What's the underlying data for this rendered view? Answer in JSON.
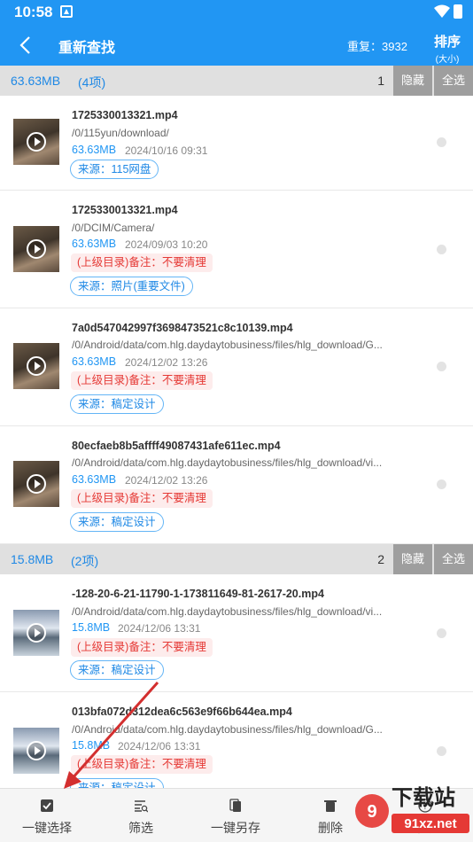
{
  "status_bar": {
    "time": "10:58"
  },
  "app_bar": {
    "title": "重新查找",
    "duplicate_label": "重复：3932",
    "sort_label": "排序",
    "sort_sub": "(大小)"
  },
  "groups": [
    {
      "size": "63.63MB",
      "count": "(4项)",
      "num": "1",
      "hide_label": "隐藏",
      "select_all_label": "全选"
    },
    {
      "size": "15.8MB",
      "count": "(2项)",
      "num": "2",
      "hide_label": "隐藏",
      "select_all_label": "全选"
    }
  ],
  "items": [
    {
      "name": "1725330013321.mp4",
      "path": "/0/115yun/download/",
      "size": "63.63MB",
      "date": "2024/10/16 09:31",
      "note": "",
      "source": "来源：115网盘"
    },
    {
      "name": "1725330013321.mp4",
      "path": "/0/DCIM/Camera/",
      "size": "63.63MB",
      "date": "2024/09/03 10:20",
      "note": "(上级目录)备注：不要清理",
      "source": "来源：照片(重要文件)"
    },
    {
      "name": "7a0d547042997f3698473521c8c10139.mp4",
      "path": "/0/Android/data/com.hlg.daydaytobusiness/files/hlg_download/G...",
      "size": "63.63MB",
      "date": "2024/12/02 13:26",
      "note": "(上级目录)备注：不要清理",
      "source": "来源：稿定设计"
    },
    {
      "name": "80ecfaeb8b5affff49087431afe611ec.mp4",
      "path": "/0/Android/data/com.hlg.daydaytobusiness/files/hlg_download/vi...",
      "size": "63.63MB",
      "date": "2024/12/02 13:26",
      "note": "(上级目录)备注：不要清理",
      "source": "来源：稿定设计"
    },
    {
      "name": "-128-20-6-21-11790-1-173811649-81-2617-20.mp4",
      "path": "/0/Android/data/com.hlg.daydaytobusiness/files/hlg_download/vi...",
      "size": "15.8MB",
      "date": "2024/12/06 13:31",
      "note": "(上级目录)备注：不要清理",
      "source": "来源：稿定设计"
    },
    {
      "name": "013bfa072d312dea6c563e9f66b644ea.mp4",
      "path": "/0/Android/data/com.hlg.daydaytobusiness/files/hlg_download/G...",
      "size": "15.8MB",
      "date": "2024/12/06 13:31",
      "note": "(上级目录)备注：不要清理",
      "source": "来源：稿定设计"
    }
  ],
  "bottom_bar": {
    "select_one": "一键选择",
    "filter": "筛选",
    "save_as": "一键另存",
    "delete": "删除",
    "help": "帮助"
  },
  "watermark": {
    "text": "下载站",
    "sub": "91xz.net"
  },
  "colors": {
    "primary": "#2196f3",
    "note_red": "#e53935",
    "arrow_red": "#d32f2f"
  }
}
